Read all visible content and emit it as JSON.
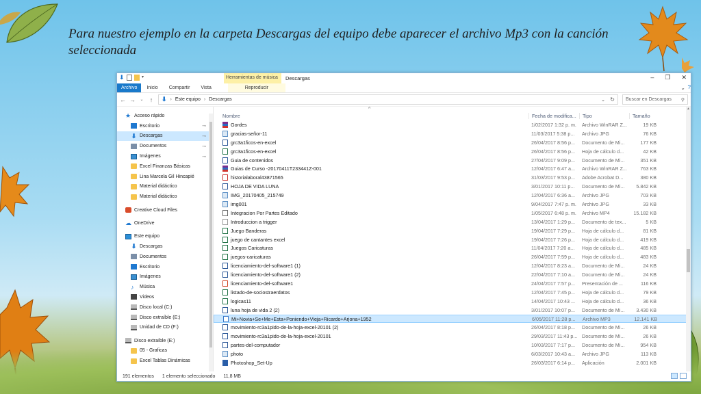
{
  "slide": {
    "title": "Para nuestro ejemplo en la carpeta Descargas del equipo debe aparecer el archivo Mp3 con la canción seleccionada"
  },
  "window": {
    "contextual_tab": "Herramientas de música",
    "title": "Descargas",
    "ribbon_tabs": [
      "Archivo",
      "Inicio",
      "Compartir",
      "Vista",
      "Reproducir"
    ],
    "address": {
      "segments": [
        "Este equipo",
        "Descargas"
      ],
      "search_placeholder": "Buscar en Descargas"
    },
    "columns": {
      "name": "Nombre",
      "date": "Fecha de modifica...",
      "type": "Tipo",
      "size": "Tamaño"
    },
    "nav": [
      {
        "label": "Acceso rápido",
        "icon": "star-icon",
        "indent": 12,
        "pinned": false
      },
      {
        "label": "Escritorio",
        "icon": "desktop-icon",
        "indent": 20,
        "pinned": true
      },
      {
        "label": "Descargas",
        "icon": "download-icon",
        "indent": 20,
        "pinned": true,
        "selected": true
      },
      {
        "label": "Documentos",
        "icon": "documents-icon",
        "indent": 20,
        "pinned": true
      },
      {
        "label": "Imágenes",
        "icon": "pictures-icon",
        "indent": 20,
        "pinned": true
      },
      {
        "label": "Excel Finanzas Básicas",
        "icon": "folder-icon",
        "indent": 20,
        "pinned": false
      },
      {
        "label": "Lina Marcela Gil Hincapié",
        "icon": "folder-icon",
        "indent": 20,
        "pinned": false
      },
      {
        "label": "Material didáctico",
        "icon": "folder-icon",
        "indent": 20,
        "pinned": false
      },
      {
        "label": "Material didáctico",
        "icon": "folder-icon",
        "indent": 20,
        "pinned": false
      },
      {
        "label": "",
        "icon": "",
        "indent": 0,
        "spacer": true
      },
      {
        "label": "Creative Cloud Files",
        "icon": "creative-cloud-icon",
        "indent": 12,
        "pinned": false
      },
      {
        "label": "",
        "icon": "",
        "indent": 0,
        "spacer": true
      },
      {
        "label": "OneDrive",
        "icon": "onedrive-icon",
        "indent": 12,
        "pinned": false
      },
      {
        "label": "",
        "icon": "",
        "indent": 0,
        "spacer": true
      },
      {
        "label": "Este equipo",
        "icon": "computer-icon",
        "indent": 12,
        "pinned": false
      },
      {
        "label": "Descargas",
        "icon": "download-icon",
        "indent": 20,
        "pinned": false
      },
      {
        "label": "Documentos",
        "icon": "documents-icon",
        "indent": 20,
        "pinned": false
      },
      {
        "label": "Escritorio",
        "icon": "desktop-icon",
        "indent": 20,
        "pinned": false
      },
      {
        "label": "Imágenes",
        "icon": "pictures-icon",
        "indent": 20,
        "pinned": false
      },
      {
        "label": "Música",
        "icon": "music-icon",
        "indent": 20,
        "pinned": false
      },
      {
        "label": "Videos",
        "icon": "videos-icon",
        "indent": 20,
        "pinned": false
      },
      {
        "label": "Disco local (C:)",
        "icon": "drive-icon",
        "indent": 20,
        "pinned": false
      },
      {
        "label": "Disco extraíble (E:)",
        "icon": "drive-icon",
        "indent": 20,
        "pinned": false
      },
      {
        "label": "Unidad de CD (F:)",
        "icon": "cd-drive-icon",
        "indent": 20,
        "pinned": false
      },
      {
        "label": "",
        "icon": "",
        "indent": 0,
        "spacer": true
      },
      {
        "label": "Disco extraíble (E:)",
        "icon": "drive-icon",
        "indent": 12,
        "pinned": false
      },
      {
        "label": "05 - Graficas",
        "icon": "folder-icon",
        "indent": 20,
        "pinned": false
      },
      {
        "label": "Excel Tablas Dinámicas",
        "icon": "folder-icon",
        "indent": 20,
        "pinned": false
      }
    ],
    "files": [
      {
        "name": "Gordes",
        "date": "1/02/2017 1:32 p. m.",
        "type": "Archivo WinRAR Z...",
        "size": "19 KB",
        "kind": "rar"
      },
      {
        "name": "gracias-señor-11",
        "date": "11/03/2017 5:38 p...",
        "type": "Archivo JPG",
        "size": "76 KB",
        "kind": "jpg"
      },
      {
        "name": "grc3a1ficos-en-excel",
        "date": "26/04/2017 8:56 p...",
        "type": "Documento de Mi...",
        "size": "177 KB",
        "kind": "doc"
      },
      {
        "name": "grc3a1ficos-en-excel",
        "date": "26/04/2017 8:56 p...",
        "type": "Hoja de cálculo d...",
        "size": "42 KB",
        "kind": "xls"
      },
      {
        "name": "Guia de contenidos",
        "date": "27/04/2017 9:09 p...",
        "type": "Documento de Mi...",
        "size": "351 KB",
        "kind": "doc"
      },
      {
        "name": "Guias de Curso -20170411T233441Z-001",
        "date": "12/04/2017 6:47 a...",
        "type": "Archivo WinRAR Z...",
        "size": "763 KB",
        "kind": "rar"
      },
      {
        "name": "historialaboral43871565",
        "date": "31/03/2017 9:53 p...",
        "type": "Adobe Acrobat D...",
        "size": "380 KB",
        "kind": "pdf"
      },
      {
        "name": "HOJA DE VIDA LUNA",
        "date": "3/01/2017 10:11 p...",
        "type": "Documento de Mi...",
        "size": "5.842 KB",
        "kind": "doc"
      },
      {
        "name": "IMG_20170405_215749",
        "date": "12/04/2017 6:36 a...",
        "type": "Archivo JPG",
        "size": "703 KB",
        "kind": "jpg"
      },
      {
        "name": "img001",
        "date": "9/04/2017 7:47 p. m.",
        "type": "Archivo JPG",
        "size": "33 KB",
        "kind": "jpg"
      },
      {
        "name": "Integracion Por Partes Editado",
        "date": "1/05/2017 6:48 p. m.",
        "type": "Archivo MP4",
        "size": "15.182 KB",
        "kind": "mp4"
      },
      {
        "name": "Introduccion a trigger",
        "date": "13/04/2017 1:29 p...",
        "type": "Documento de tex...",
        "size": "5 KB",
        "kind": "txt"
      },
      {
        "name": "Juego Banderas",
        "date": "19/04/2017 7:29 p...",
        "type": "Hoja de cálculo d...",
        "size": "81 KB",
        "kind": "xls"
      },
      {
        "name": "juego de cantantes excel",
        "date": "19/04/2017 7:26 p...",
        "type": "Hoja de cálculo d...",
        "size": "419 KB",
        "kind": "xls"
      },
      {
        "name": "Juegos Caricaturas",
        "date": "11/04/2017 7:20 a...",
        "type": "Hoja de cálculo d...",
        "size": "485 KB",
        "kind": "xls"
      },
      {
        "name": "juegos-caricaturas",
        "date": "26/04/2017 7:59 p...",
        "type": "Hoja de cálculo d...",
        "size": "483 KB",
        "kind": "xls"
      },
      {
        "name": "licenciamiento-del-software1 (1)",
        "date": "12/04/2017 8:23 a...",
        "type": "Documento de Mi...",
        "size": "24 KB",
        "kind": "doc"
      },
      {
        "name": "licenciamiento-del-software1 (2)",
        "date": "22/04/2017 7:10 a...",
        "type": "Documento de Mi...",
        "size": "24 KB",
        "kind": "doc"
      },
      {
        "name": "licenciamiento-del-software1",
        "date": "24/04/2017 7:57 p...",
        "type": "Presentación de ...",
        "size": "116 KB",
        "kind": "ppt"
      },
      {
        "name": "listado-de-sociostraerdatos",
        "date": "12/04/2017 7:45 p...",
        "type": "Hoja de cálculo d...",
        "size": "79 KB",
        "kind": "xls"
      },
      {
        "name": "logicas11",
        "date": "14/04/2017 10:43 ...",
        "type": "Hoja de cálculo d...",
        "size": "36 KB",
        "kind": "xls"
      },
      {
        "name": "luna hoja de vida 2 (2)",
        "date": "3/01/2017 10:07 p...",
        "type": "Documento de Mi...",
        "size": "3.430 KB",
        "kind": "doc"
      },
      {
        "name": "Mi+Novia+Se+Me+Esta+Poniendo+Vieja+Ricardo+Arjona+1952",
        "date": "6/05/2017 11:28 p...",
        "type": "Archivo MP3",
        "size": "12.141 KB",
        "kind": "mp3",
        "selected": true
      },
      {
        "name": "movimiento-rc3a1pido-de-la-hoja-excel-20101 (2)",
        "date": "26/04/2017 8:18 p...",
        "type": "Documento de Mi...",
        "size": "26 KB",
        "kind": "doc"
      },
      {
        "name": "movimiento-rc3a1pido-de-la-hoja-excel-20101",
        "date": "29/03/2017 11:43 p...",
        "type": "Documento de Mi...",
        "size": "26 KB",
        "kind": "doc"
      },
      {
        "name": "partes-del-computador",
        "date": "10/03/2017 7:17 p...",
        "type": "Documento de Mi...",
        "size": "954 KB",
        "kind": "doc"
      },
      {
        "name": "photo",
        "date": "6/03/2017 10:43 a...",
        "type": "Archivo JPG",
        "size": "113 KB",
        "kind": "jpg"
      },
      {
        "name": "Photoshop_Set-Up",
        "date": "26/03/2017 6:14 p...",
        "type": "Aplicación",
        "size": "2.001 KB",
        "kind": "app"
      }
    ],
    "status": {
      "count": "191 elementos",
      "selection": "1 elemento seleccionado",
      "size": "11,8 MB"
    }
  },
  "colors": {
    "accent": "#1979ca",
    "selection": "#cce8ff",
    "contextual_tab": "#fdf0a6"
  }
}
